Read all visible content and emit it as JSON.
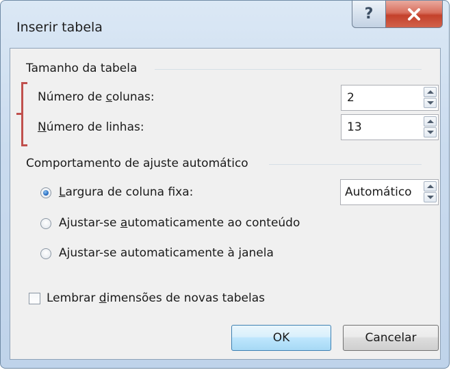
{
  "window": {
    "title": "Inserir tabela",
    "help_glyph": "?",
    "close_icon": "close-icon"
  },
  "size_group": {
    "title": "Tamanho da tabela",
    "columns": {
      "label_pre": "Número de ",
      "label_key": "c",
      "label_post": "olunas:",
      "value": "2"
    },
    "rows": {
      "label_pre": "",
      "label_key": "N",
      "label_post": "úmero de linhas:",
      "value": "13"
    }
  },
  "autofit_group": {
    "title": "Comportamento de ajuste automático",
    "fixed": {
      "label_pre": "",
      "label_key": "L",
      "label_post": "argura de coluna fixa:",
      "value": "Automático",
      "selected": true
    },
    "contents": {
      "label_pre": "Ajustar-se ",
      "label_key": "a",
      "label_post": "utomaticamente ao conteúdo",
      "selected": false
    },
    "window": {
      "label_pre": "Ajustar-se automaticamente à ",
      "label_key": "j",
      "label_post": "anela",
      "selected": false
    }
  },
  "remember": {
    "label_pre": "Lembrar ",
    "label_key": "d",
    "label_post": "imensões de novas tabelas",
    "checked": false
  },
  "buttons": {
    "ok": "OK",
    "cancel": "Cancelar"
  },
  "colors": {
    "annotation_bracket": "#c0504d",
    "close_button": "#c4412b",
    "ok_border": "#3c7fb1"
  }
}
